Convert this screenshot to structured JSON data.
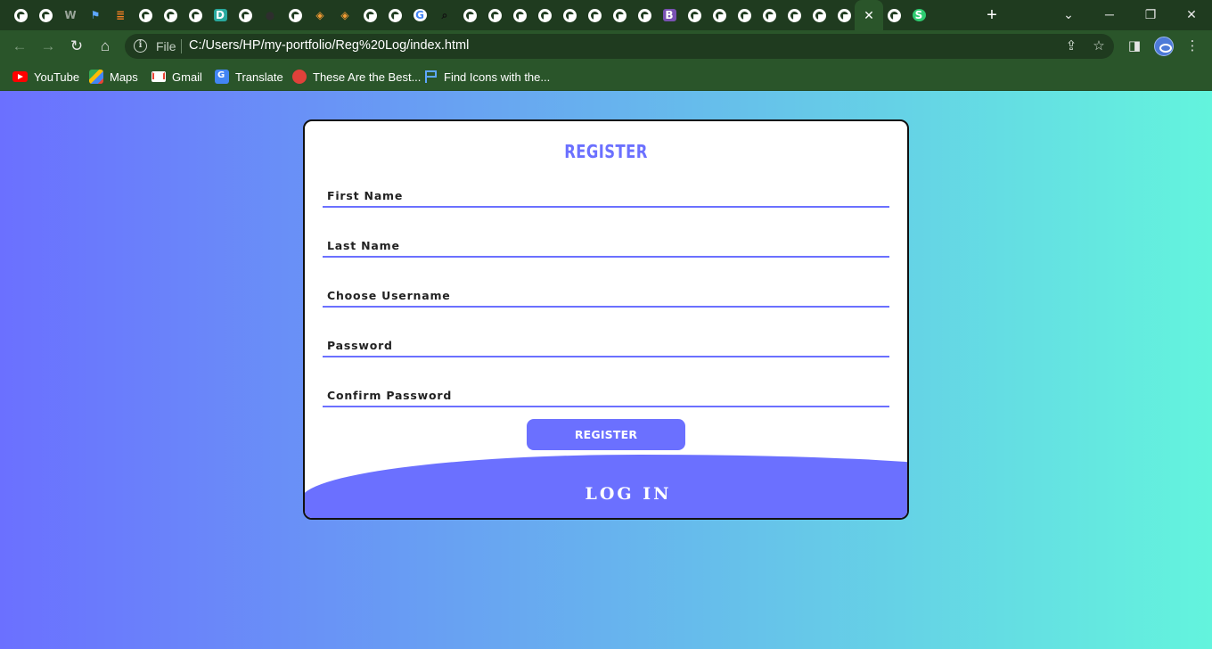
{
  "browser": {
    "address": {
      "scheme_label": "File",
      "url": "C:/Users/HP/my-portfolio/Reg%20Log/index.html"
    },
    "tabs": {
      "favicons": [
        "globe",
        "globe",
        "w3",
        "flag",
        "stack",
        "globe",
        "globe",
        "globe",
        "dl",
        "globe",
        "github",
        "globe",
        "diamond",
        "diamond",
        "globe",
        "globe",
        "google",
        "search",
        "globe",
        "globe",
        "globe",
        "globe",
        "globe",
        "globe",
        "globe",
        "globe",
        "bootstrap",
        "globe",
        "globe",
        "globe",
        "globe",
        "globe",
        "globe",
        "globe",
        "active-close",
        "globe",
        "s-circle"
      ],
      "active_close_glyph": "✕",
      "w3_text": "W",
      "dl_text": "D",
      "bootstrap_text": "B",
      "s_text": "S"
    },
    "bookmarks": [
      {
        "label": "YouTube",
        "icon": "youtube-icon"
      },
      {
        "label": "Maps",
        "icon": "maps-icon"
      },
      {
        "label": "Gmail",
        "icon": "gmail-icon"
      },
      {
        "label": "Translate",
        "icon": "translate-icon"
      },
      {
        "label": "These Are the Best...",
        "icon": "acrobat-icon"
      },
      {
        "label": "Find Icons with the...",
        "icon": "flag-icon"
      }
    ],
    "colors": {
      "chrome_dark": "#1f3b1f",
      "chrome": "#2a552a"
    }
  },
  "form": {
    "title": "REGISTER",
    "fields": {
      "first_name": {
        "placeholder": "First Name",
        "value": ""
      },
      "last_name": {
        "placeholder": "Last Name",
        "value": ""
      },
      "username": {
        "placeholder": "Choose Username",
        "value": ""
      },
      "password": {
        "placeholder": "Password",
        "value": ""
      },
      "confirm_password": {
        "placeholder": "Confirm Password",
        "value": ""
      }
    },
    "register_button": "REGISTER",
    "login_label": "LOG IN"
  },
  "theme": {
    "accent": "#6b70ff",
    "gradient_start": "#6b70ff",
    "gradient_end": "#63f4dd"
  }
}
